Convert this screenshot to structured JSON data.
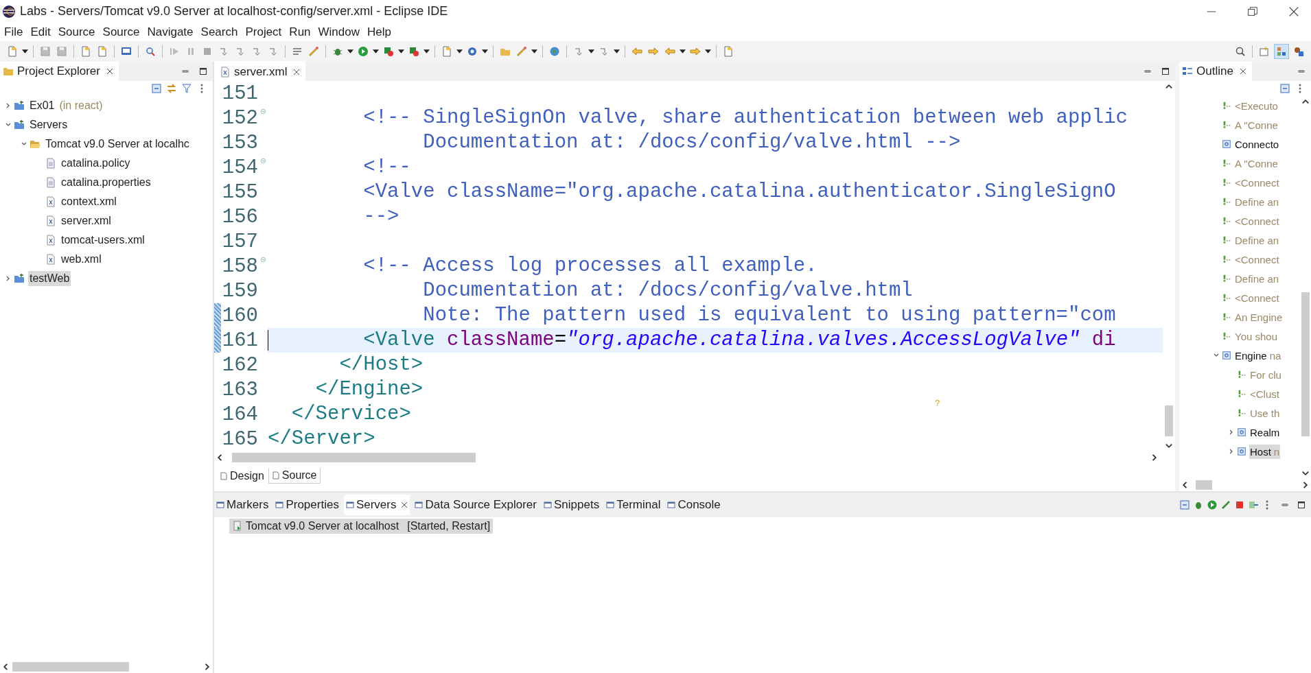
{
  "window": {
    "title": "Labs - Servers/Tomcat v9.0 Server at localhost-config/server.xml - Eclipse IDE"
  },
  "menu": [
    "File",
    "Edit",
    "Source",
    "Source",
    "Navigate",
    "Search",
    "Project",
    "Run",
    "Window",
    "Help"
  ],
  "project_explorer": {
    "title": "Project Explorer",
    "tree": [
      {
        "label": "Ex01",
        "decoration": "(in react)",
        "kind": "project",
        "expanded": false,
        "selected": false
      },
      {
        "label": "Servers",
        "kind": "project",
        "expanded": true,
        "selected": false,
        "children": [
          {
            "label": "Tomcat v9.0 Server at localhc",
            "kind": "folder",
            "expanded": true,
            "selected": false,
            "children": [
              {
                "label": "catalina.policy",
                "kind": "text-file",
                "selected": false
              },
              {
                "label": "catalina.properties",
                "kind": "text-file",
                "selected": false
              },
              {
                "label": "context.xml",
                "kind": "xml-file",
                "selected": false
              },
              {
                "label": "server.xml",
                "kind": "xml-file",
                "selected": false
              },
              {
                "label": "tomcat-users.xml",
                "kind": "xml-file",
                "selected": false
              },
              {
                "label": "web.xml",
                "kind": "xml-file",
                "selected": false
              }
            ]
          }
        ]
      },
      {
        "label": "testWeb",
        "kind": "project",
        "expanded": false,
        "selected": true
      }
    ]
  },
  "editor": {
    "tabs": [
      {
        "label": "server.xml",
        "selected": true
      }
    ],
    "lines": [
      {
        "number": "151",
        "foldable": false,
        "changed": false,
        "current": false
      },
      {
        "number": "152",
        "foldable": true,
        "changed": false,
        "current": false,
        "tokens": [
          {
            "kind": "comment",
            "text": "        <!-- SingleSignOn valve, share authentication between web applic"
          }
        ]
      },
      {
        "number": "153",
        "foldable": false,
        "changed": false,
        "current": false,
        "tokens": [
          {
            "kind": "comment",
            "text": "             Documentation at: /docs/config/valve.html -->"
          }
        ]
      },
      {
        "number": "154",
        "foldable": true,
        "changed": false,
        "current": false,
        "tokens": [
          {
            "kind": "comment",
            "text": "        <!--"
          }
        ]
      },
      {
        "number": "155",
        "foldable": false,
        "changed": false,
        "current": false,
        "tokens": [
          {
            "kind": "comment",
            "text": "        <Valve className=\"org.apache.catalina.authenticator.SingleSignO"
          }
        ]
      },
      {
        "number": "156",
        "foldable": false,
        "changed": false,
        "current": false,
        "tokens": [
          {
            "kind": "comment",
            "text": "        -->"
          }
        ]
      },
      {
        "number": "157",
        "foldable": false,
        "changed": false,
        "current": false
      },
      {
        "number": "158",
        "foldable": true,
        "changed": false,
        "current": false,
        "tokens": [
          {
            "kind": "comment",
            "text": "        <!-- Access log processes all example."
          }
        ]
      },
      {
        "number": "159",
        "foldable": false,
        "changed": false,
        "current": false,
        "tokens": [
          {
            "kind": "comment",
            "text": "             Documentation at: /docs/config/valve.html"
          }
        ]
      },
      {
        "number": "160",
        "foldable": false,
        "changed": true,
        "current": false,
        "tokens": [
          {
            "kind": "comment",
            "text": "             Note: The pattern used is equivalent to using pattern=\"com"
          }
        ]
      },
      {
        "number": "161",
        "foldable": false,
        "changed": true,
        "current": true,
        "tokens": [
          {
            "kind": "tag",
            "text": "        <Valve"
          },
          {
            "kind": "attr",
            "text": " className"
          },
          {
            "kind": "punct",
            "text": "="
          },
          {
            "kind": "value",
            "text": "\"org.apache.catalina.valves.AccessLogValve\""
          },
          {
            "kind": "attr",
            "text": " di"
          }
        ]
      },
      {
        "number": "162",
        "foldable": false,
        "changed": false,
        "current": false,
        "tokens": [
          {
            "kind": "tag",
            "text": "      </Host>"
          }
        ]
      },
      {
        "number": "163",
        "foldable": false,
        "changed": false,
        "current": false,
        "tokens": [
          {
            "kind": "tag",
            "text": "    </Engine>"
          }
        ]
      },
      {
        "number": "164",
        "foldable": false,
        "changed": false,
        "current": false,
        "tokens": [
          {
            "kind": "tag",
            "text": "  </Service>"
          }
        ]
      },
      {
        "number": "165",
        "foldable": false,
        "changed": false,
        "current": false,
        "tokens": [
          {
            "kind": "tag",
            "text": "</Server>"
          }
        ]
      }
    ],
    "help_marker": "?",
    "mode_tabs": [
      {
        "label": "Design",
        "selected": false
      },
      {
        "label": "Source",
        "selected": true
      }
    ]
  },
  "outline": {
    "title": "Outline",
    "tree": [
      {
        "label": "<Executo",
        "kind": "comment",
        "selected": false
      },
      {
        "label": "A \"Conne",
        "kind": "comment",
        "selected": false
      },
      {
        "label": "Connecto",
        "kind": "element",
        "selected": false
      },
      {
        "label": "A \"Conne",
        "kind": "comment",
        "selected": false
      },
      {
        "label": "<Connect",
        "kind": "comment",
        "selected": false
      },
      {
        "label": "Define an",
        "kind": "comment",
        "selected": false
      },
      {
        "label": "<Connect",
        "kind": "comment",
        "selected": false
      },
      {
        "label": "Define an",
        "kind": "comment",
        "selected": false
      },
      {
        "label": "<Connect",
        "kind": "comment",
        "selected": false
      },
      {
        "label": "Define an",
        "kind": "comment",
        "selected": false
      },
      {
        "label": "<Connect",
        "kind": "comment",
        "selected": false
      },
      {
        "label": "An Engine",
        "kind": "comment",
        "selected": false
      },
      {
        "label": "You shou",
        "kind": "comment",
        "selected": false
      },
      {
        "label": "Engine",
        "detail": "na",
        "kind": "element",
        "expanded": true,
        "selected": false,
        "children": [
          {
            "label": "For clu",
            "kind": "comment",
            "selected": false
          },
          {
            "label": "<Clust",
            "kind": "comment",
            "selected": false
          },
          {
            "label": "Use th",
            "kind": "comment",
            "selected": false
          },
          {
            "label": "Realm",
            "kind": "element",
            "expanded": false,
            "selected": false
          },
          {
            "label": "Host",
            "detail": "n",
            "kind": "element",
            "expanded": false,
            "selected": true
          }
        ]
      }
    ]
  },
  "bottom_panel": {
    "tabs": [
      {
        "label": "Markers",
        "selected": false
      },
      {
        "label": "Properties",
        "selected": false
      },
      {
        "label": "Servers",
        "selected": true
      },
      {
        "label": "Data Source Explorer",
        "selected": false
      },
      {
        "label": "Snippets",
        "selected": false
      },
      {
        "label": "Terminal",
        "selected": false
      },
      {
        "label": "Console",
        "selected": false
      }
    ],
    "servers": [
      {
        "name": "Tomcat v9.0 Server at localhost",
        "state": "[Started, Restart]",
        "selected": true
      }
    ]
  }
}
